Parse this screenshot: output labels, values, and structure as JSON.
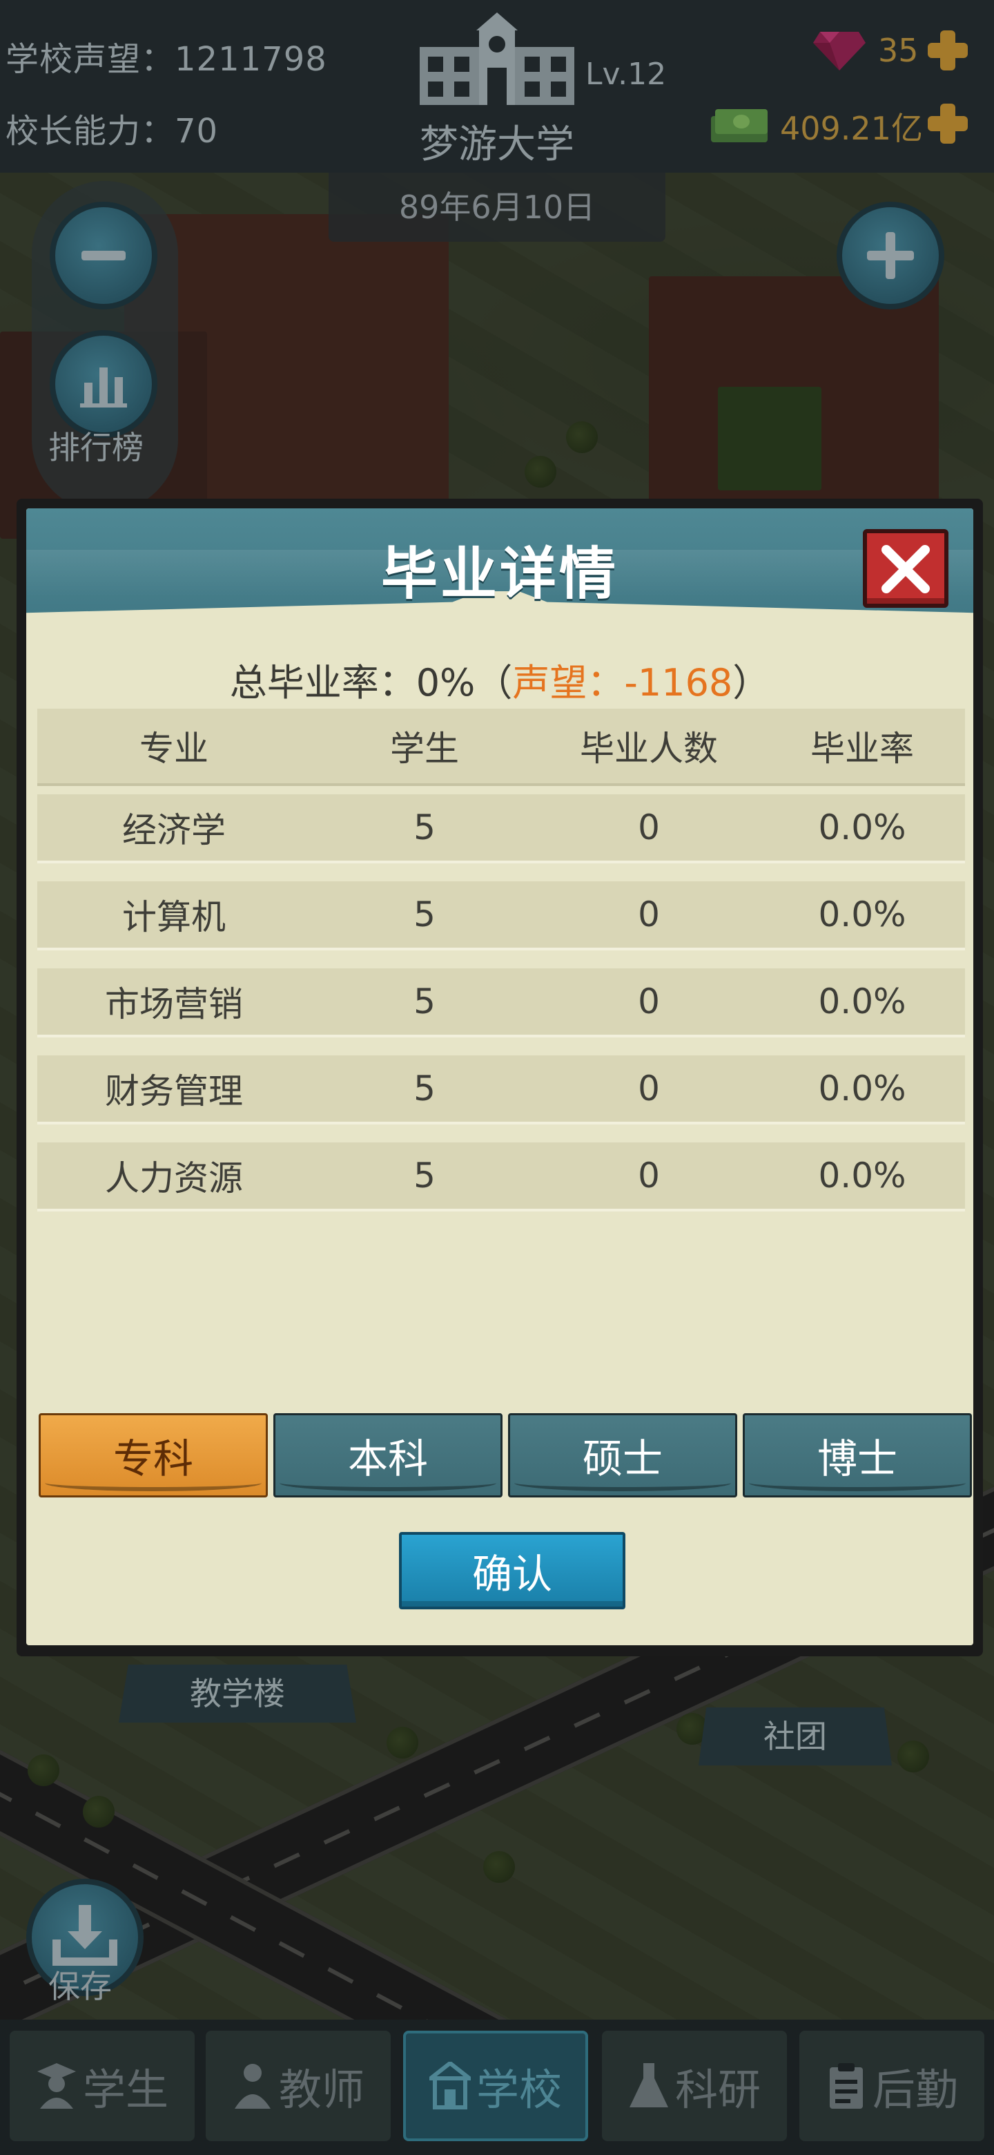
{
  "topbar": {
    "reputation_label": "学校声望：",
    "reputation_value": "1211798",
    "ability_label": "校长能力：",
    "ability_value": "70",
    "school_level": "Lv.12",
    "school_name": "梦游大学",
    "gems": "35",
    "money": "409.21亿",
    "date": "89年6月10日"
  },
  "map": {
    "zoom_out_icon": "minus-icon",
    "zoom_in_icon": "plus-icon",
    "ranking_label": "排行榜",
    "save_label": "保存",
    "building_label_1": "教学楼",
    "building_label_2": "社团"
  },
  "dialog": {
    "title": "毕业详情",
    "summary_prefix": "总毕业率：",
    "summary_rate": "0%",
    "summary_open": "（",
    "summary_rep": "声望：-1168",
    "summary_close": "）",
    "headers": [
      "专业",
      "学生",
      "毕业人数",
      "毕业率"
    ],
    "rows": [
      {
        "major": "经济学",
        "students": "5",
        "graduates": "0",
        "rate": "0.0%"
      },
      {
        "major": "计算机",
        "students": "5",
        "graduates": "0",
        "rate": "0.0%"
      },
      {
        "major": "市场营销",
        "students": "5",
        "graduates": "0",
        "rate": "0.0%"
      },
      {
        "major": "财务管理",
        "students": "5",
        "graduates": "0",
        "rate": "0.0%"
      },
      {
        "major": "人力资源",
        "students": "5",
        "graduates": "0",
        "rate": "0.0%"
      }
    ],
    "tabs": [
      "专科",
      "本科",
      "硕士",
      "博士"
    ],
    "active_tab": "专科",
    "confirm_label": "确认"
  },
  "nav": [
    {
      "label": "学生",
      "icon": "student-icon",
      "active": false
    },
    {
      "label": "教师",
      "icon": "teacher-icon",
      "active": false
    },
    {
      "label": "学校",
      "icon": "school-icon",
      "active": true
    },
    {
      "label": "科研",
      "icon": "flask-icon",
      "active": false
    },
    {
      "label": "后勤",
      "icon": "clipboard-icon",
      "active": false
    }
  ],
  "colors": {
    "accent_orange": "#e5741f",
    "tab_active": "#e89a38",
    "tab_inactive": "#437480",
    "confirm": "#2493c0",
    "close": "#c12f2f"
  }
}
